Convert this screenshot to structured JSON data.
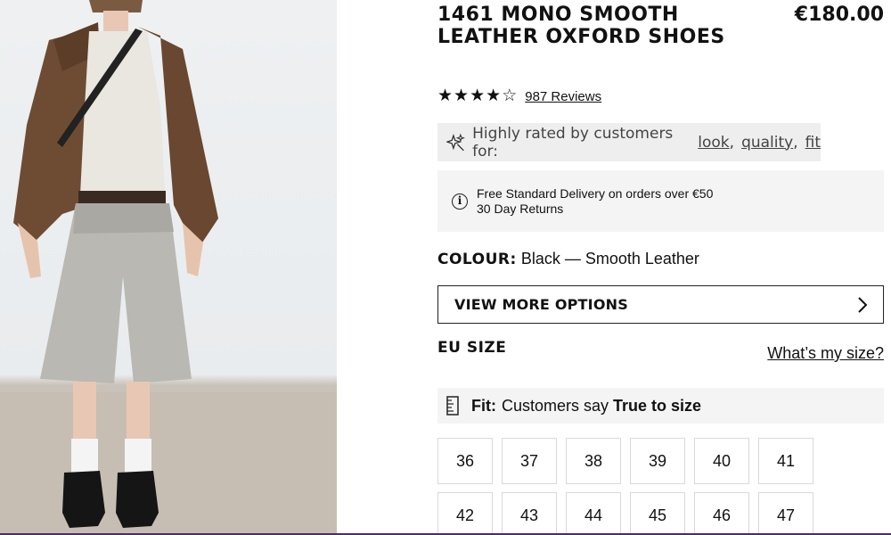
{
  "product": {
    "title": "1461 MONO SMOOTH LEATHER OXFORD SHOES",
    "price": "€180.00"
  },
  "rating": {
    "value": 4,
    "max": 5,
    "reviews_link": "987 Reviews"
  },
  "highlight": {
    "prefix": "Highly rated by customers for:",
    "tags": [
      "look",
      "quality",
      "fit"
    ],
    "icon": "sparkle-icon"
  },
  "delivery": {
    "line1": "Free Standard Delivery on orders over €50",
    "line2": "30 Day Returns",
    "icon": "info-icon"
  },
  "colour": {
    "label": "COLOUR:",
    "value": "Black — Smooth Leather"
  },
  "options_button": {
    "label": "VIEW MORE OPTIONS",
    "icon": "chevron-right-icon"
  },
  "size": {
    "label": "EU SIZE",
    "guide_link": "What’s my size?"
  },
  "fit": {
    "label": "Fit:",
    "text": "Customers say",
    "value": "True to size",
    "icon": "ruler-icon"
  },
  "sizes": [
    "36",
    "37",
    "38",
    "39",
    "40",
    "41",
    "42",
    "43",
    "44",
    "45",
    "46",
    "47"
  ],
  "colors": {
    "accent_bar": "#4b2b70",
    "panel_bg": "#f4f4f4",
    "highlight_bg": "#eeeeee"
  }
}
